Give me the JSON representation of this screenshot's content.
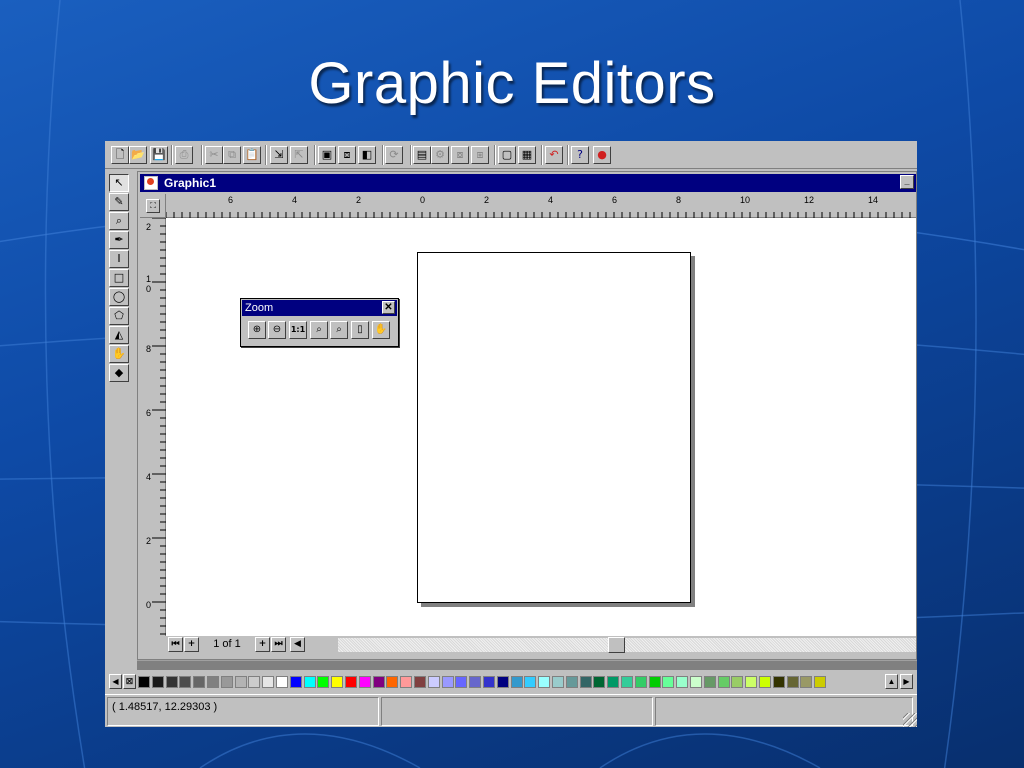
{
  "slide": {
    "title": "Graphic Editors"
  },
  "toolbar": {
    "buttons": [
      {
        "name": "new-document-button",
        "icon": "new-doc-icon",
        "glyph": "🗋",
        "dim": false
      },
      {
        "name": "open-button",
        "icon": "open-folder-icon",
        "glyph": "📂",
        "dim": false
      },
      {
        "name": "save-button",
        "icon": "save-disk-icon",
        "glyph": "💾",
        "dim": false
      },
      {
        "name": "print-button",
        "icon": "printer-icon",
        "glyph": "⎙",
        "dim": true
      },
      {
        "name": "cut-button",
        "icon": "scissors-icon",
        "glyph": "✂",
        "dim": true
      },
      {
        "name": "copy-button",
        "icon": "copy-icon",
        "glyph": "⧉",
        "dim": true
      },
      {
        "name": "paste-button",
        "icon": "clipboard-icon",
        "glyph": "📋",
        "dim": false
      },
      {
        "name": "import-button",
        "icon": "import-icon",
        "glyph": "⇲",
        "dim": false
      },
      {
        "name": "export-button",
        "icon": "export-icon",
        "glyph": "⇱",
        "dim": true
      },
      {
        "name": "view-button",
        "icon": "monitor-icon",
        "glyph": "▣",
        "dim": false
      },
      {
        "name": "arrange-button",
        "icon": "arrange-icon",
        "glyph": "⧈",
        "dim": false
      },
      {
        "name": "align-button",
        "icon": "align-icon",
        "glyph": "◧",
        "dim": false
      },
      {
        "name": "rotate-button",
        "icon": "rotate-icon",
        "glyph": "⟳",
        "dim": true
      },
      {
        "name": "effects-button",
        "icon": "effects-icon",
        "glyph": "▤",
        "dim": false
      },
      {
        "name": "gear-button",
        "icon": "gear-icon",
        "glyph": "⚙",
        "dim": true
      },
      {
        "name": "group-button",
        "icon": "group-icon",
        "glyph": "⧇",
        "dim": true
      },
      {
        "name": "ungroup-button",
        "icon": "ungroup-icon",
        "glyph": "⧆",
        "dim": true
      },
      {
        "name": "frame-button",
        "icon": "frame-icon",
        "glyph": "▢",
        "dim": false
      },
      {
        "name": "picture-button",
        "icon": "picture-icon",
        "glyph": "▦",
        "dim": false
      },
      {
        "name": "undo-button",
        "icon": "undo-icon",
        "glyph": "↶",
        "dim": false
      },
      {
        "name": "help-button",
        "icon": "help-pointer-icon",
        "glyph": "?",
        "dim": false
      },
      {
        "name": "apple-button",
        "icon": "apple-icon",
        "glyph": "●",
        "dim": false
      }
    ]
  },
  "tools": [
    {
      "name": "select-tool",
      "icon": "arrow-pointer-icon",
      "glyph": "↖",
      "active": true
    },
    {
      "name": "freehand-tool",
      "icon": "pen-icon",
      "glyph": "✎",
      "active": false
    },
    {
      "name": "zoom-tool",
      "icon": "magnifier-icon",
      "glyph": "⌕",
      "active": false
    },
    {
      "name": "edit-tool",
      "icon": "nib-icon",
      "glyph": "✒",
      "active": false
    },
    {
      "name": "text-tool",
      "icon": "text-cursor-icon",
      "glyph": "I",
      "active": false
    },
    {
      "name": "rectangle-tool",
      "icon": "rectangle-icon",
      "glyph": "□",
      "active": false
    },
    {
      "name": "ellipse-tool",
      "icon": "ellipse-icon",
      "glyph": "◯",
      "active": false
    },
    {
      "name": "polygon-tool",
      "icon": "polygon-icon",
      "glyph": "⬠",
      "active": false
    },
    {
      "name": "outline-tool",
      "icon": "outline-pen-icon",
      "glyph": "◭",
      "active": false
    },
    {
      "name": "fill-hand-tool",
      "icon": "hand-icon",
      "glyph": "✋",
      "active": false
    },
    {
      "name": "fill-tool",
      "icon": "paint-bucket-icon",
      "glyph": "◆",
      "active": false
    }
  ],
  "document": {
    "title": "Graphic1",
    "minimize_glyph": "_"
  },
  "ruler": {
    "top_labels": [
      "6",
      "4",
      "2",
      "0",
      "2",
      "4",
      "6",
      "8",
      "10",
      "12",
      "14"
    ],
    "left_labels": [
      "2",
      "1\n0",
      "8",
      "6",
      "4",
      "2",
      "0"
    ]
  },
  "zoom_palette": {
    "title": "Zoom",
    "close_glyph": "✕",
    "buttons": [
      {
        "name": "zoom-in-button",
        "icon": "zoom-in-icon",
        "glyph": "⊕"
      },
      {
        "name": "zoom-out-button",
        "icon": "zoom-out-icon",
        "glyph": "⊖"
      },
      {
        "name": "zoom-actual-button",
        "icon": "actual-size-icon",
        "glyph": "1:1"
      },
      {
        "name": "zoom-selection-button",
        "icon": "zoom-selection-icon",
        "glyph": "⌕"
      },
      {
        "name": "zoom-all-button",
        "icon": "zoom-all-icon",
        "glyph": "⌕"
      },
      {
        "name": "zoom-page-button",
        "icon": "page-icon",
        "glyph": "▯"
      },
      {
        "name": "pan-button",
        "icon": "hand-pan-icon",
        "glyph": "✋"
      }
    ]
  },
  "pager": {
    "page_indicator": "1 of 1",
    "first_glyph": "⏮",
    "add_glyph": "+",
    "add_after_glyph": "+",
    "last_glyph": "⏭",
    "left_glyph": "◀"
  },
  "palette": {
    "left_glyph": "◀",
    "right_glyph": "▶",
    "scroll_glyph": "▲",
    "colors": [
      "#000000",
      "#1a1a1a",
      "#333333",
      "#4d4d4d",
      "#666666",
      "#808080",
      "#999999",
      "#b3b3b3",
      "#cccccc",
      "#e6e6e6",
      "#ffffff",
      "#0000ff",
      "#00ffff",
      "#00ff00",
      "#ffff00",
      "#ff0000",
      "#ff00ff",
      "#800080",
      "#ff6600",
      "#ff9999",
      "#804040",
      "#ccccff",
      "#9999ff",
      "#6666ff",
      "#6666cc",
      "#3333cc",
      "#000080",
      "#3399cc",
      "#33ccff",
      "#99ffff",
      "#99cccc",
      "#669999",
      "#336666",
      "#006633",
      "#009966",
      "#33cc99",
      "#33cc66",
      "#00cc00",
      "#66ff99",
      "#99ffcc",
      "#ccffcc",
      "#669966",
      "#66cc66",
      "#99cc66",
      "#ccff66",
      "#ccff00",
      "#333300",
      "#666633",
      "#999966",
      "#cccc00"
    ]
  },
  "status": {
    "coordinates": "( 1.48517, 12.29303 )"
  }
}
